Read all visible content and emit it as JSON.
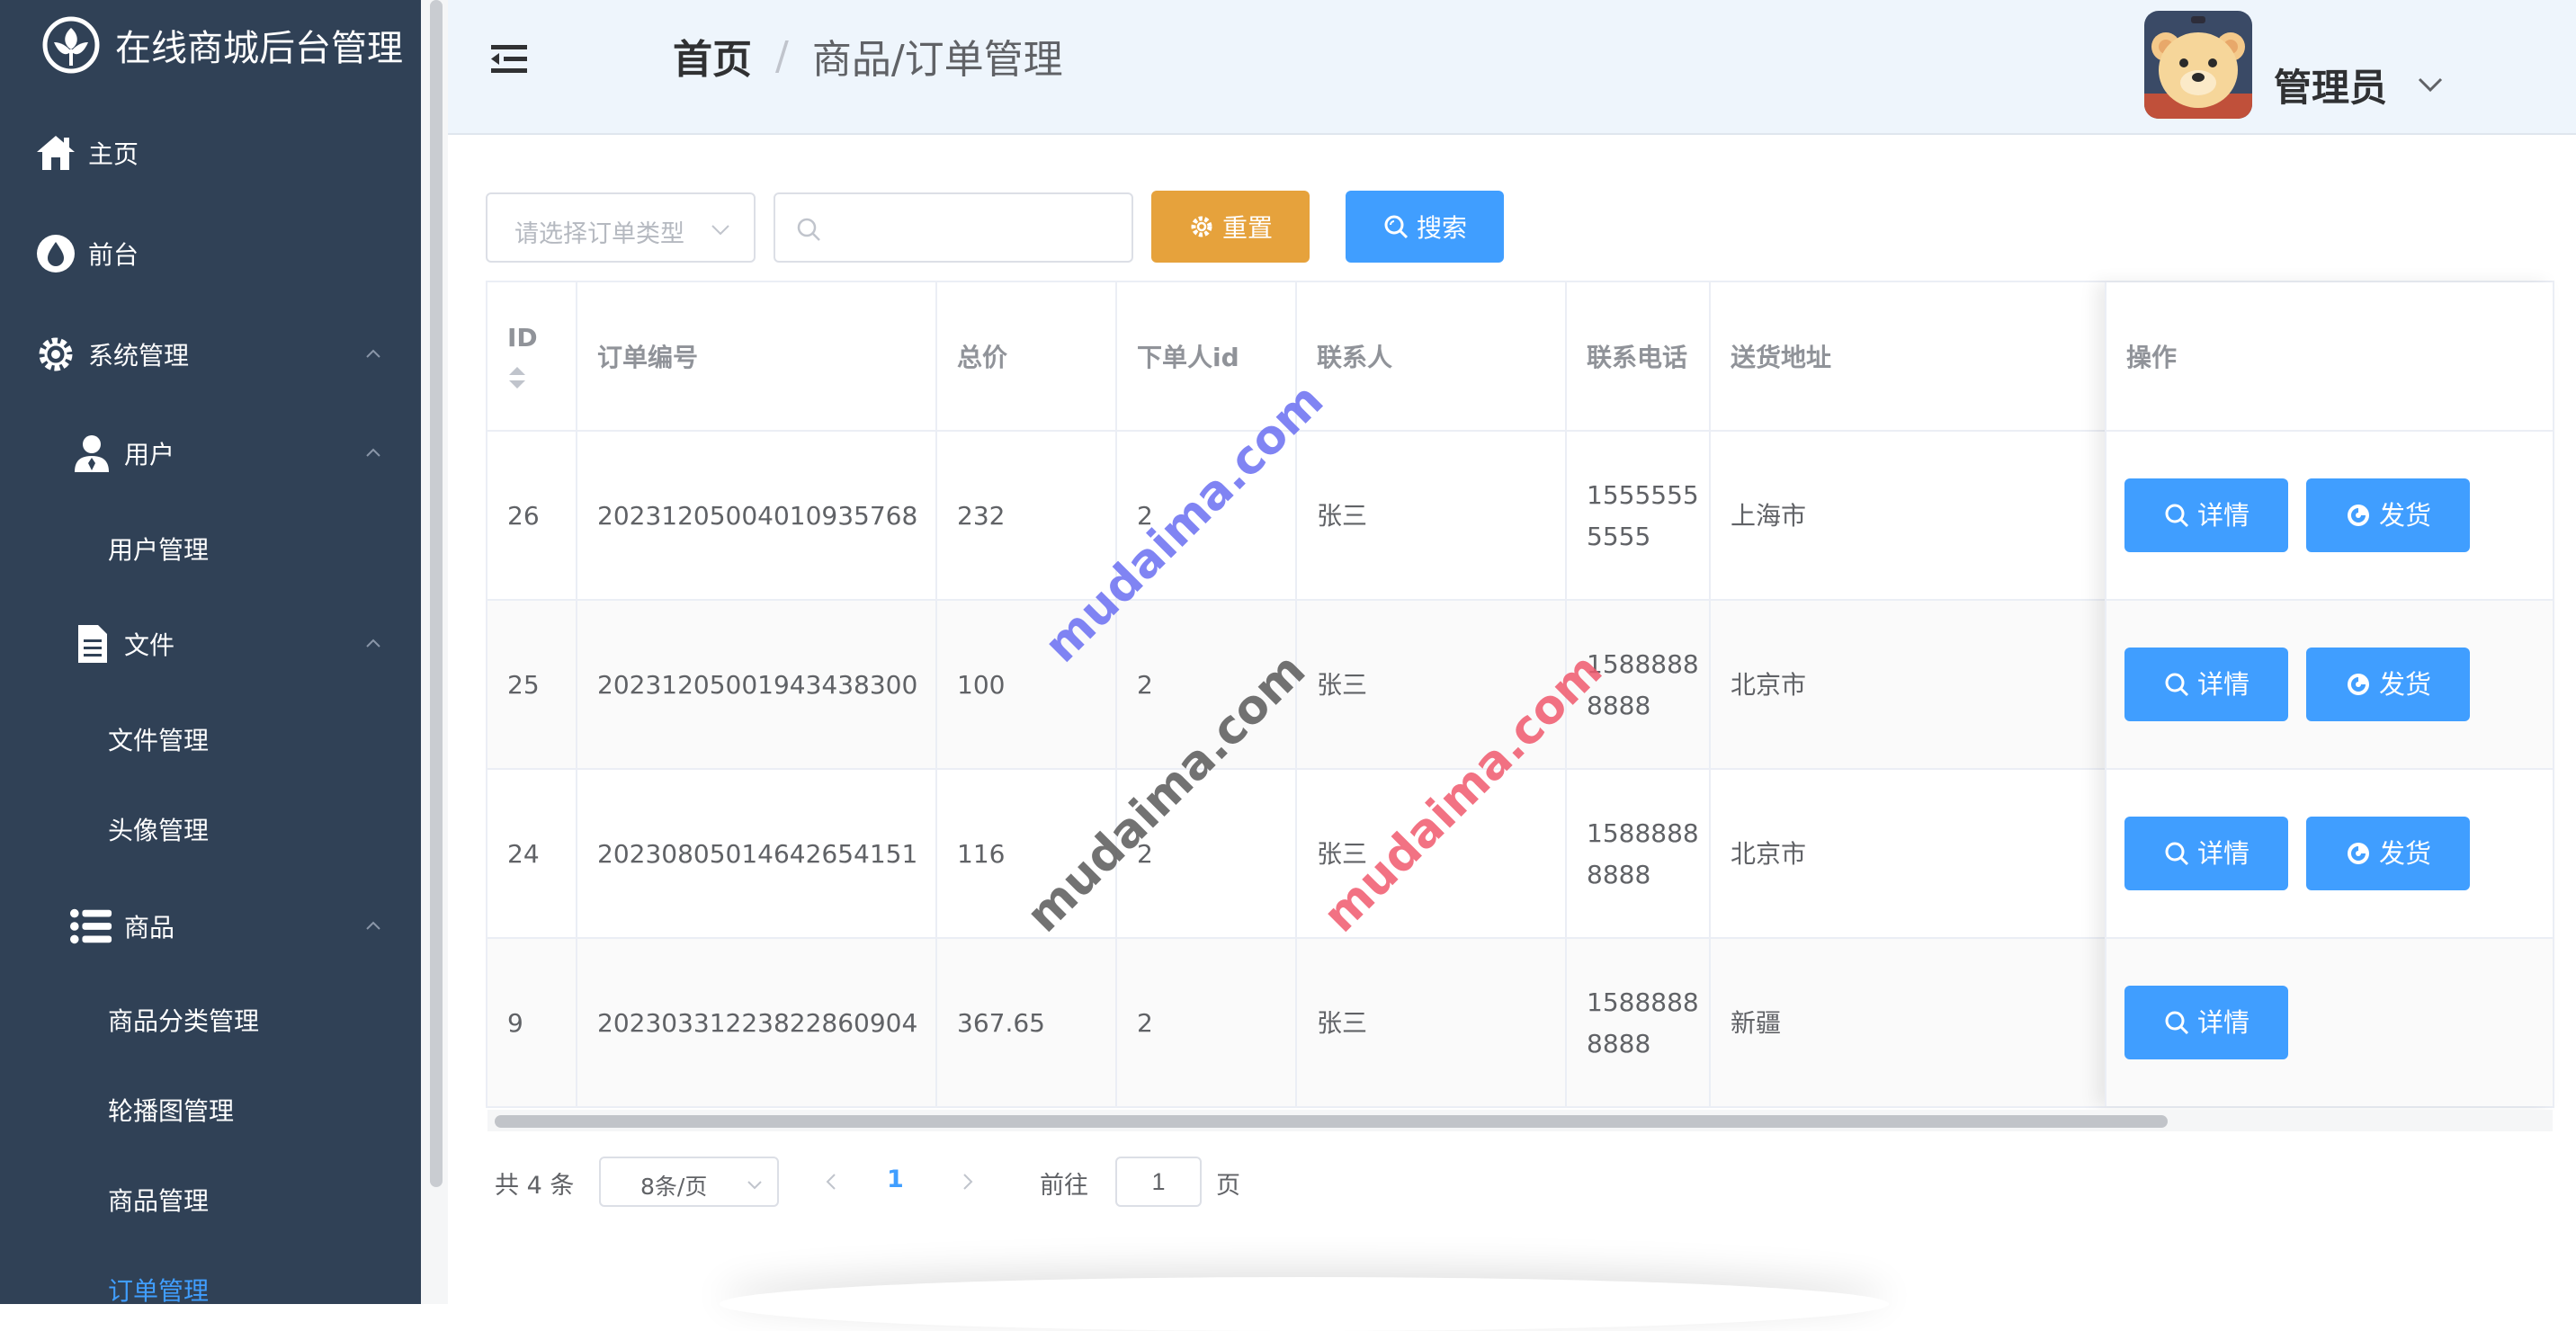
{
  "app": {
    "title": "在线商城后台管理"
  },
  "sidebar": {
    "items": [
      {
        "label": "主页",
        "icon": "home-icon"
      },
      {
        "label": "前台",
        "icon": "drop-icon"
      },
      {
        "label": "系统管理",
        "icon": "gear-icon"
      },
      {
        "label": "用户",
        "icon": "user-icon"
      },
      {
        "label": "用户管理"
      },
      {
        "label": "文件",
        "icon": "document-icon"
      },
      {
        "label": "文件管理"
      },
      {
        "label": "头像管理"
      },
      {
        "label": "商品",
        "icon": "list-icon"
      },
      {
        "label": "商品分类管理"
      },
      {
        "label": "轮播图管理"
      },
      {
        "label": "商品管理"
      },
      {
        "label": "订单管理",
        "active": true
      }
    ]
  },
  "header": {
    "breadcrumb": {
      "home": "首页",
      "separator": "/",
      "current": "商品/订单管理"
    },
    "user": {
      "name": "管理员"
    }
  },
  "toolbar": {
    "order_type_placeholder": "请选择订单类型",
    "search_value": "",
    "reset_label": "重置",
    "search_label": "搜索"
  },
  "table": {
    "columns": [
      "ID",
      "订单编号",
      "总价",
      "下单人id",
      "联系人",
      "联系电话",
      "送货地址",
      "操作"
    ],
    "rows": [
      {
        "id": "26",
        "order_no": "20231205004010935768",
        "total": "232",
        "user_id": "2",
        "contact": "张三",
        "phone": "15555555555",
        "address": "上海市",
        "ship": true
      },
      {
        "id": "25",
        "order_no": "20231205001943438300",
        "total": "100",
        "user_id": "2",
        "contact": "张三",
        "phone": "15888888888",
        "address": "北京市",
        "ship": true
      },
      {
        "id": "24",
        "order_no": "20230805014642654151",
        "total": "116",
        "user_id": "2",
        "contact": "张三",
        "phone": "15888888888",
        "address": "北京市",
        "ship": true
      },
      {
        "id": "9",
        "order_no": "20230331223822860904",
        "total": "367.65",
        "user_id": "2",
        "contact": "张三",
        "phone": "15888888888",
        "address": "新疆",
        "ship": false
      }
    ],
    "detail_label": "详情",
    "ship_label": "发货"
  },
  "pagination": {
    "total_text": "共 4 条",
    "page_size": "8条/页",
    "current_page": "1",
    "goto_label": "前往",
    "goto_value": "1",
    "goto_suffix": "页"
  },
  "watermarks": [
    "mudaima.com",
    "mudaima.com",
    "mudaima.com"
  ],
  "colors": {
    "sidebar_bg": "#304156",
    "primary": "#409eff",
    "warning": "#e6a23c",
    "header_bg": "#eef5fc"
  }
}
